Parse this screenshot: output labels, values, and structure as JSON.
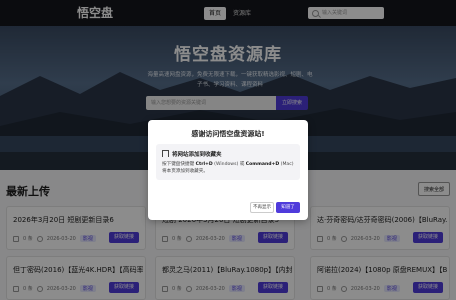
{
  "header": {
    "logo": "悟空盘",
    "nav_home": "首页",
    "nav_library": "资源库",
    "search_placeholder": "输入关键词"
  },
  "hero": {
    "title": "悟空盘资源库",
    "subtitle": "海量高速网盘资源，免费无限速下载，一键获取精选影视、短剧、电子书、学习资料、课程资料",
    "search_placeholder": "输入您想要的资源关键词",
    "search_button": "立即搜索"
  },
  "section": {
    "title": "最新上传",
    "more_button": "搜索全部"
  },
  "cards": [
    {
      "title": "2026年3月20日 短剧更新目录6",
      "count": "0 条",
      "date": "2026-03-20",
      "tag": "影视",
      "button": "获取链接"
    },
    {
      "title": "短剧 2026年3月20日 短剧更新目录5",
      "count": "0 条",
      "date": "2026-03-20",
      "tag": "影视",
      "button": "获取链接"
    },
    {
      "title": "达·芬奇密码/达芬奇密码(2006)【BluRay.1080p",
      "count": "0 条",
      "date": "2026-03-20",
      "tag": "影视",
      "button": "获取链接"
    },
    {
      "title": "但丁密码(2016)【蓝光4K.HDR】【高码率】",
      "count": "0 条",
      "date": "2026-03-20",
      "tag": "影视",
      "button": "获取链接"
    },
    {
      "title": "都灵之马(2011)【BluRay.1080p】【内封简",
      "count": "0 条",
      "date": "2026-03-20",
      "tag": "影视",
      "button": "获取链接"
    },
    {
      "title": "阿诺拉(2024)【1080p 原盘REMUX】【BluRay",
      "count": "0 条",
      "date": "2026-03-20",
      "tag": "影视",
      "button": "获取链接"
    }
  ],
  "modal": {
    "title": "感谢访问悟空盘资源站!",
    "box_heading": "将网站添加到收藏夹",
    "text_1": "按下键盘快捷键 ",
    "shortcut_windows": "Ctrl+D",
    "text_2": " (Windows) 或 ",
    "shortcut_mac": "Command+D",
    "text_3": " (Mac) 将本页添加到收藏夹。",
    "later_button": "不再显示",
    "ok_button": "知道了"
  },
  "colors": {
    "accent": "#4f3bdb",
    "header_bg": "#15171c"
  }
}
